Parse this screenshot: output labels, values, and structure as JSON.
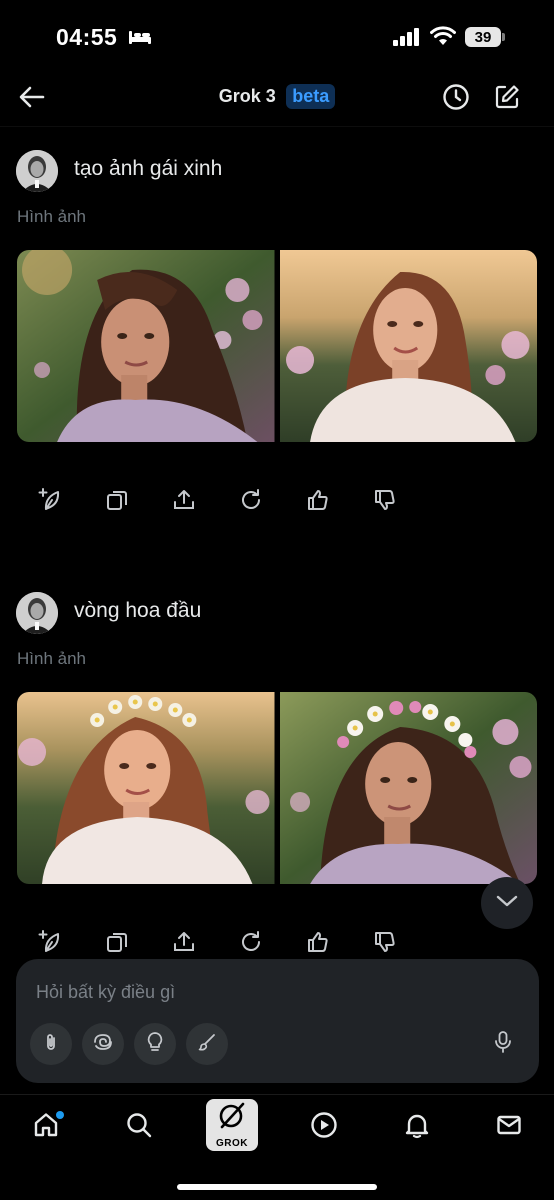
{
  "status_bar": {
    "time": "04:55",
    "battery": "39"
  },
  "header": {
    "title": "Grok 3",
    "badge": "beta"
  },
  "messages": [
    {
      "prompt": "tạo ảnh gái xinh",
      "label": "Hình ảnh"
    },
    {
      "prompt": "vòng hoa đầu",
      "label": "Hình ảnh"
    }
  ],
  "composer": {
    "placeholder": "Hỏi bất kỳ điều gì"
  },
  "nav": {
    "grok_label": "GROK"
  },
  "icons": {
    "back": "arrow-left-icon",
    "history": "clock-icon",
    "compose": "compose-icon",
    "actions": [
      "edit-image-icon",
      "copy-icon",
      "share-icon",
      "regenerate-icon",
      "thumbs-up-icon",
      "thumbs-down-icon"
    ],
    "tools": [
      "paperclip-icon",
      "swirl-icon",
      "lightbulb-icon",
      "brush-icon",
      "microphone-icon"
    ],
    "nav": [
      "home-icon",
      "search-icon",
      "grok-icon",
      "play-icon",
      "bell-icon",
      "mail-icon"
    ]
  },
  "colors": {
    "accent": "#1d9bf0",
    "beta_text": "#3b9cff",
    "beta_bg": "#0e2f55",
    "composer_bg": "#202327"
  }
}
